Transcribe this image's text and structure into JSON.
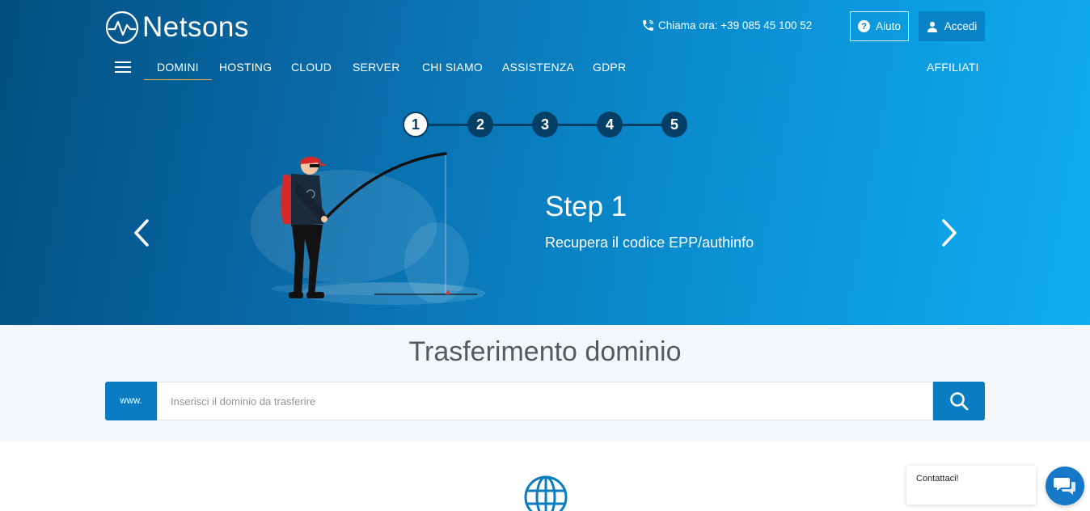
{
  "header": {
    "logo_text": "Netsons",
    "phone_label": "Chiama ora: +39 085 45 100 52",
    "help_label": "Aiuto",
    "login_label": "Accedi"
  },
  "nav": {
    "items": [
      {
        "label": "DOMINI",
        "active": true
      },
      {
        "label": "HOSTING"
      },
      {
        "label": "CLOUD"
      },
      {
        "label": "SERVER"
      },
      {
        "label": "CHI SIAMO"
      },
      {
        "label": "ASSISTENZA"
      },
      {
        "label": "GDPR"
      }
    ],
    "affiliates_label": "AFFILIATI"
  },
  "stepper": {
    "steps": [
      "1",
      "2",
      "3",
      "4",
      "5"
    ],
    "current": 1
  },
  "slide": {
    "title": "Step 1",
    "subtitle": "Recupera il codice EPP/authinfo"
  },
  "transfer": {
    "title": "Trasferimento dominio",
    "prefix": "www.",
    "placeholder": "Inserisci il dominio da trasferire",
    "value": ""
  },
  "chat": {
    "bubble_text": "Contattaci!"
  },
  "colors": {
    "accent": "#0a7dc2",
    "step_dark": "#063f66",
    "nav_underline": "#d6b24a"
  },
  "icons": {
    "phone": "phone-icon",
    "help": "question-circle-icon",
    "user": "user-icon",
    "search": "search-icon",
    "prev": "chevron-left-icon",
    "next": "chevron-right-icon",
    "globe": "globe-icon",
    "chat": "chat-icon"
  }
}
